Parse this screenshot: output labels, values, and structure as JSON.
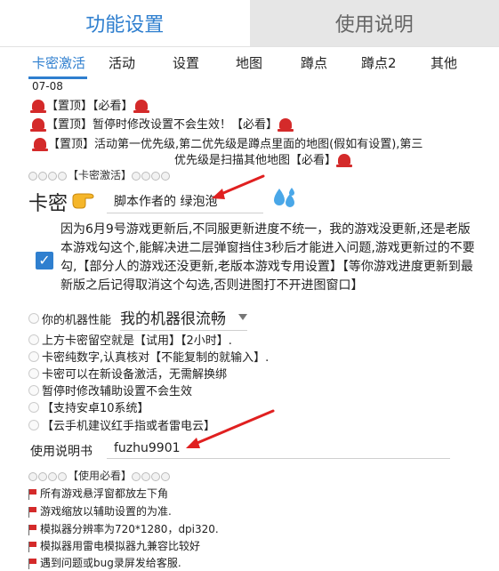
{
  "tabs": {
    "features": "功能设置",
    "instructions": "使用说明"
  },
  "subtabs": [
    {
      "label": "卡密激活"
    },
    {
      "label": "活动"
    },
    {
      "label": "设置"
    },
    {
      "label": "地图"
    },
    {
      "label": "蹲点"
    },
    {
      "label": "蹲点2"
    },
    {
      "label": "其他"
    }
  ],
  "notice": {
    "date": "07-08",
    "line1": "【置顶】【必看】",
    "line2": "【置顶】暂停时修改设置不会生效！【必看】",
    "line3a": "【置顶】活动第一优先级,第二优先级是蹲点里面的地图(假如有设置),第三",
    "line3b": "优先级是扫描其他地图【必看】"
  },
  "activation": {
    "section_title": "【卡密激活】",
    "card_label": "卡密",
    "card_value": "脚本作者的 绿泡泡",
    "option_text": "因为6月9号游戏更新后,不同服更新进度不统一，我的游戏没更新,还是老版本游戏勾这个,能解决进二层弹窗挡住3秒后才能进入问题,游戏更新过的不要勾,【部分人的游戏还没更新,老版本游戏专用设置】【等你游戏进度更新到最新版之后记得取消这个勾选,否则进图打不开进图窗口】",
    "option_checked": true,
    "perf_label": "你的机器性能",
    "perf_value": "我的机器很流畅",
    "tips": [
      "上方卡密留空就是【试用】【2小时】.",
      "卡密纯数字,认真核对【不能复制的就输入】.",
      "卡密可以在新设备激活，无需解换绑",
      "暂停时修改辅助设置不会生效",
      "【支持安卓10系统】",
      "【云手机建议红手指或者雷电云】"
    ]
  },
  "manual": {
    "label": "使用说明书",
    "value": "fuzhu9901",
    "section_title": "【使用必看】",
    "notes": [
      "所有游戏悬浮窗都放左下角",
      "游戏缩放以辅助设置的为准.",
      "模拟器分辨率为720*1280，dpi320.",
      "模拟器用雷电模拟器九兼容比较好",
      "遇到问题或bug录屏发给客服."
    ]
  },
  "colors": {
    "accent": "#2f7fcf",
    "alarm": "#d42a2a",
    "arrow": "#e02020"
  }
}
